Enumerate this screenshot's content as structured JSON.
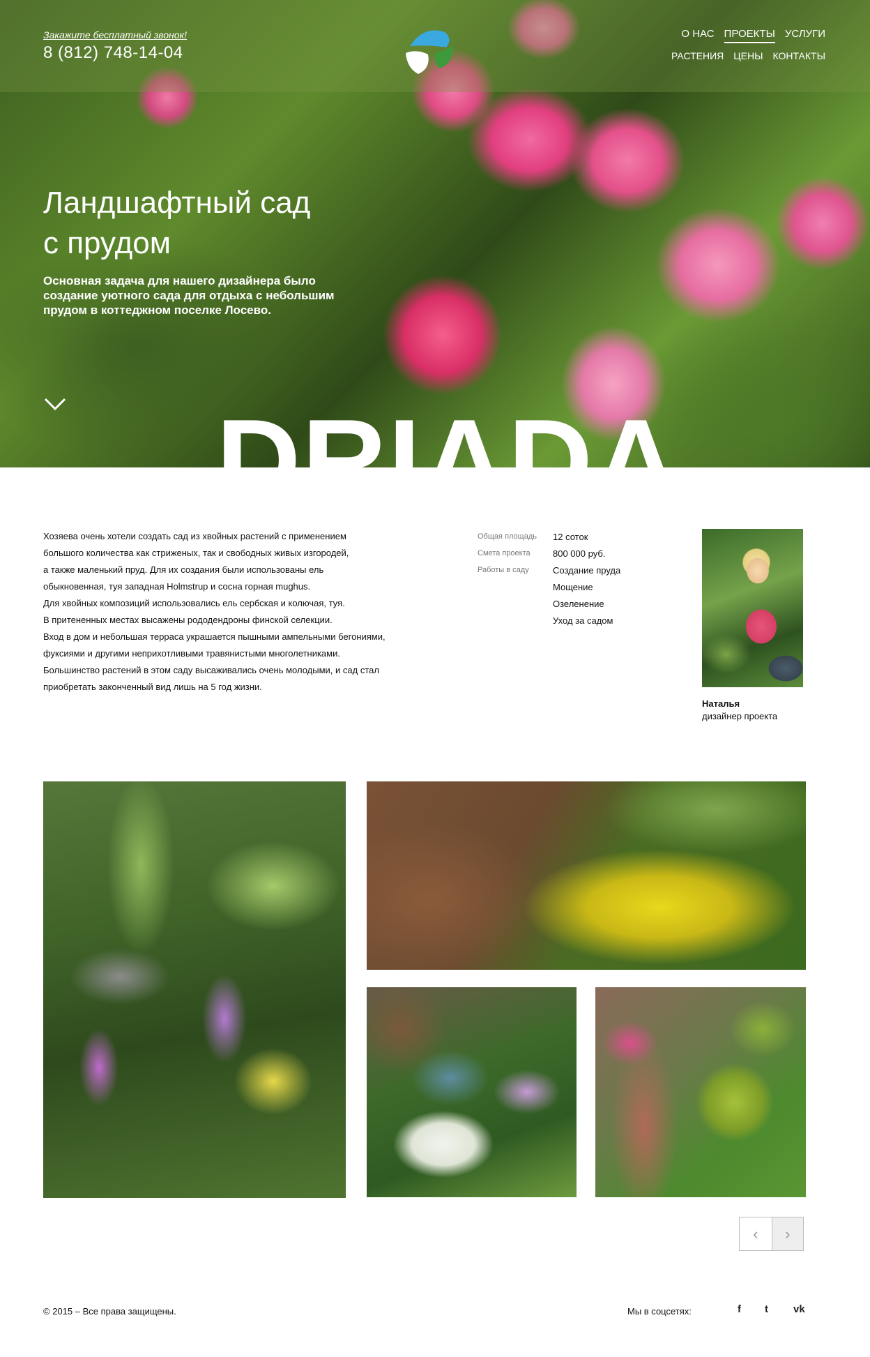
{
  "header": {
    "call_link": "Закажите бесплатный звонок!",
    "phone": "8 (812) 748-14-04",
    "nav_row1": [
      "О НАС",
      "ПРОЕКТЫ",
      "УСЛУГИ"
    ],
    "nav_row2": [
      "РАСТЕНИЯ",
      "ЦЕНЫ",
      "КОНТАКТЫ"
    ],
    "active_nav": "ПРОЕКТЫ"
  },
  "hero": {
    "title_line1": "Ландшафтный сад",
    "title_line2": "с прудом",
    "description": "Основная задача  для нашего дизайнера было создание уютного сада для отдыха с небольшим прудом в коттеджном поселке Лосево.",
    "brand": "DRIADA"
  },
  "project": {
    "text": [
      "Хозяева очень хотели создать сад из хвойных растений с применением",
      "большого количества как стриженых, так и свободных живых изгородей,",
      "а также маленький пруд. Для их создания были использованы ель",
      "обыкновенная, туя западная Holmstrup и сосна горная mughus.",
      "Для хвойных композиций использовались ель сербская и колючая, туя.",
      "В притененных местах высажены рододендроны финской селекции.",
      "Вход в дом и небольшая терраса украшается пышными ампельными  бегониями,",
      "фуксиями и другими неприхотливыми травянистыми многолетниками.",
      "Большинство растений в этом саду высаживались очень молодыми, и сад стал",
      "приобретать законченный вид лишь на 5 год жизни."
    ],
    "specs": {
      "area_label": "Общая площадь",
      "area_value": "12 соток",
      "budget_label": "Смета проекта",
      "budget_value": "800 000 руб.",
      "works_label": "Работы в саду",
      "works": [
        "Создание пруда",
        "Мощение",
        "Озеленение",
        "Уход за садом"
      ]
    },
    "designer": {
      "name": "Наталья",
      "role": "дизайнер проекта"
    }
  },
  "pager": {
    "prev": "‹",
    "next": "›"
  },
  "footer": {
    "copyright": "© 2015 – Все права защищены.",
    "social_label": "Мы в соцсетях:",
    "social": [
      "f",
      "t",
      "vk"
    ]
  },
  "colors": {
    "logo_blue": "#3aa9e0",
    "logo_green": "#3d9a3a",
    "pager_border": "#bdbdbd"
  }
}
